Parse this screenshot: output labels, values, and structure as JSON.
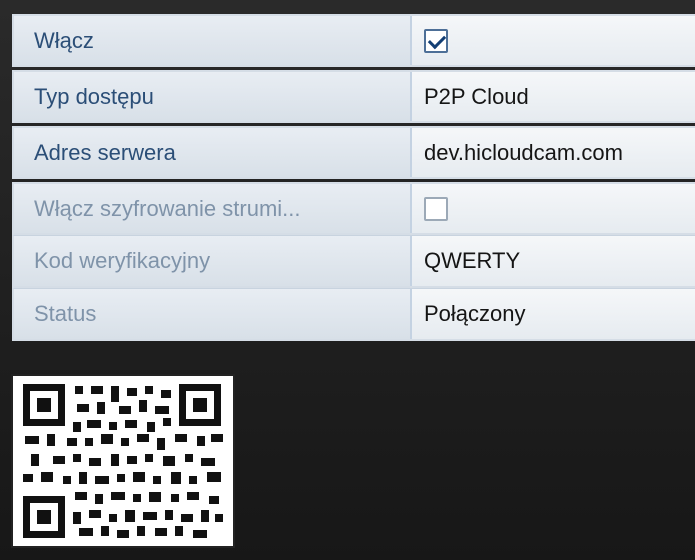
{
  "form": {
    "rows": [
      {
        "label": "Włącz",
        "value": "",
        "checkbox": "checked"
      },
      {
        "label": "Typ dostępu",
        "value": "P2P Cloud"
      },
      {
        "label": "Adres serwera",
        "value": "dev.hicloudcam.com"
      },
      {
        "label": "Włącz szyfrowanie strumi...",
        "value": "",
        "checkbox": "unchecked"
      },
      {
        "label": "Kod weryfikacyjny",
        "value": "QWERTY"
      },
      {
        "label": "Status",
        "value": "Połączony"
      }
    ]
  },
  "colors": {
    "label_text": "#2b4e77",
    "label_text_dim": "#7f93a9",
    "checkbox_border": "#4d6f97",
    "background": "#1e1e1e"
  },
  "qr": {
    "icon": "qr-code-icon"
  }
}
